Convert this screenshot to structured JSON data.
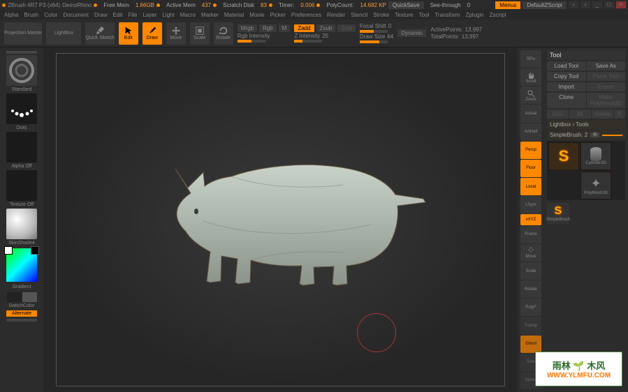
{
  "titlebar": {
    "app": "ZBrush 4R7 P3 (x64)",
    "doc": "DemoRhino",
    "free_mem_label": "Free Mem",
    "free_mem": "1.66GB",
    "active_mem_label": "Active Mem",
    "active_mem": "437",
    "scratch_label": "Scratch Disk",
    "scratch": "83",
    "timer_label": "Timer:",
    "timer": "0.006",
    "poly_label": "PolyCount:",
    "poly": "14.682 KP",
    "quicksave": "QuickSave",
    "seethrough_label": "See-through",
    "seethrough": "0",
    "menus": "Menus",
    "script": "DefaultZScript"
  },
  "menu": [
    "Alpha",
    "Brush",
    "Color",
    "Document",
    "Draw",
    "Edit",
    "File",
    "Layer",
    "Light",
    "Macro",
    "Marker",
    "Material",
    "Movie",
    "Picker",
    "Preferences",
    "Render",
    "Stencil",
    "Stroke",
    "Texture",
    "Tool",
    "Transform",
    "Zplugin",
    "Zscript"
  ],
  "toolbar": {
    "projection": "Projection Master",
    "lightbox": "LightBox",
    "quicksketch": "Quick Sketch",
    "edit": "Edit",
    "draw": "Draw",
    "move": "Move",
    "scale": "Scale",
    "rotate": "Rotate",
    "mrgb": "Mrgb",
    "rgb": "Rgb",
    "m": "M",
    "rgb_intensity_label": "Rgb Intensity",
    "zadd": "Zadd",
    "zsub": "Zsub",
    "zcut": "Zcut",
    "z_intensity_label": "Z Intensity",
    "z_intensity": "25",
    "focal_label": "Focal Shift",
    "focal": "0",
    "drawsize_label": "Draw Size",
    "drawsize": "64",
    "dynamic": "Dynamic",
    "active_label": "ActivePoints:",
    "active": "13,997",
    "total_label": "TotalPoints:",
    "total": "13,997"
  },
  "left": {
    "standard": "Standard",
    "dots": "Dots",
    "alpha_off": "Alpha Off",
    "texture_off": "Texture Off",
    "skinshade": "SkinShade4",
    "gradient": "Gradient",
    "switchcolor": "SwitchColor",
    "alternate": "Alternate"
  },
  "right_tools": [
    "SPix",
    "Scroll",
    "Zoom",
    "Actual",
    "AAHalf",
    "Persp",
    "Floor",
    "Local",
    "LSym",
    "xXYZ",
    "Frame",
    "Move",
    "Scale",
    "Rotate",
    "PolyF",
    "Transp",
    "Ghost",
    "Solo",
    "Xpose"
  ],
  "tool_panel": {
    "title": "Tool",
    "load": "Load Tool",
    "saveas": "Save As",
    "copy": "Copy Tool",
    "paste": "Paste Tool",
    "import": "Import",
    "export": "Export",
    "clone": "Clone",
    "make": "Make PolyMesh3D",
    "goz": "GoZ",
    "all": "All",
    "visible": "Visible",
    "r": "R",
    "lightbox": "Lightbox › Tools",
    "simplebrush": "SimpleBrush. 2",
    "items": [
      "SimpleBrush",
      "Cylinder3D",
      "PolyMesh3D"
    ],
    "active_tool": "SimpleBrush"
  },
  "watermark": {
    "cn": "雨林 🌱 木风",
    "url": "WWW.YLMFU.COM"
  }
}
